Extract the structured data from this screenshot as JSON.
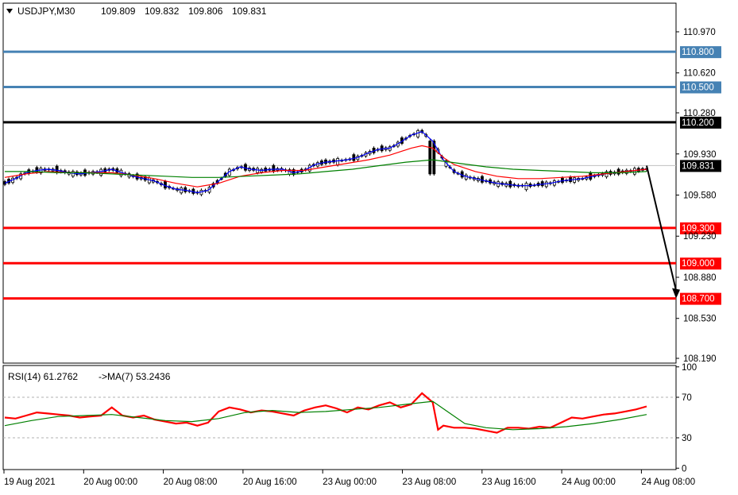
{
  "header": {
    "symbol": "USDJPY,M30",
    "open": "109.809",
    "high": "109.832",
    "low": "109.806",
    "close": "109.831"
  },
  "rsi_header": {
    "label": "RSI(14) 61.2762",
    "ma_label": "->MA(7) 53.2436"
  },
  "chart_data": [
    {
      "type": "candlestick",
      "title": "USDJPY,M30",
      "price_ticks": [
        "110.970",
        "110.620",
        "110.280",
        "109.930",
        "109.580",
        "109.230",
        "108.880",
        "108.530",
        "108.190"
      ],
      "ylim": [
        108.19,
        111.16
      ],
      "x_ticks": [
        "19 Aug 2021",
        "20 Aug 00:00",
        "20 Aug 08:00",
        "20 Aug 16:00",
        "23 Aug 00:00",
        "23 Aug 08:00",
        "23 Aug 16:00",
        "24 Aug 00:00",
        "24 Aug 08:00"
      ],
      "current_price": "109.831",
      "levels": [
        {
          "label": "110.800",
          "value": 110.8,
          "color": "#4682b4",
          "kind": "resistance"
        },
        {
          "label": "110.500",
          "value": 110.5,
          "color": "#4682b4",
          "kind": "resistance"
        },
        {
          "label": "110.200",
          "value": 110.2,
          "color": "#000000",
          "kind": "pivot"
        },
        {
          "label": "109.300",
          "value": 109.3,
          "color": "#ff0000",
          "kind": "support"
        },
        {
          "label": "109.000",
          "value": 109.0,
          "color": "#ff0000",
          "kind": "support"
        },
        {
          "label": "108.700",
          "value": 108.7,
          "color": "#ff0000",
          "kind": "support"
        }
      ],
      "series": [
        {
          "color": "#0000ff",
          "kind": "moving-average",
          "x": [
            0,
            4,
            8,
            12,
            16,
            20,
            24,
            28,
            32,
            36,
            40,
            44,
            48,
            52,
            56,
            60,
            64,
            68,
            72,
            76,
            80,
            84,
            88,
            92,
            96,
            100,
            104,
            108,
            112,
            116,
            120,
            124,
            128,
            132,
            136,
            140,
            144,
            148,
            152,
            156,
            160,
            164,
            168,
            172,
            176,
            180,
            184,
            188,
            192,
            196,
            200,
            204,
            208,
            212,
            216,
            220,
            224,
            228,
            232,
            236,
            240
          ],
          "y": [
            109.68,
            109.72,
            109.77,
            109.79,
            109.8,
            109.79,
            109.77,
            109.76,
            109.77,
            109.78,
            109.8,
            109.77,
            109.74,
            109.72,
            109.7,
            109.66,
            109.63,
            109.62,
            109.6,
            109.62,
            109.7,
            109.78,
            109.82,
            109.8,
            109.79,
            109.8,
            109.8,
            109.77,
            109.79,
            109.84,
            109.86,
            109.87,
            109.88,
            109.9,
            109.94,
            109.97,
            109.98,
            110.03,
            110.09,
            110.12,
            110.04,
            109.88,
            109.78,
            109.74,
            109.72,
            109.7,
            109.68,
            109.67,
            109.66,
            109.66,
            109.67,
            109.68,
            109.7,
            109.71,
            109.72,
            109.74,
            109.76,
            109.77,
            109.78,
            109.79,
            109.8
          ]
        },
        {
          "color": "#ff0000",
          "kind": "moving-average",
          "x": [
            0,
            8,
            16,
            24,
            32,
            40,
            48,
            56,
            64,
            72,
            80,
            88,
            96,
            104,
            112,
            120,
            128,
            136,
            144,
            152,
            156,
            160,
            164,
            168,
            176,
            184,
            192,
            200,
            208,
            216,
            224,
            232,
            240
          ],
          "y": [
            109.73,
            109.76,
            109.78,
            109.77,
            109.77,
            109.77,
            109.75,
            109.72,
            109.68,
            109.65,
            109.68,
            109.74,
            109.77,
            109.79,
            109.79,
            109.82,
            109.85,
            109.88,
            109.92,
            109.98,
            110.0,
            109.98,
            109.9,
            109.84,
            109.78,
            109.74,
            109.72,
            109.72,
            109.73,
            109.74,
            109.76,
            109.78,
            109.8
          ]
        },
        {
          "color": "#008000",
          "kind": "moving-average",
          "x": [
            0,
            10,
            20,
            30,
            40,
            50,
            60,
            70,
            80,
            90,
            100,
            110,
            120,
            130,
            140,
            150,
            160,
            170,
            180,
            190,
            200,
            210,
            220,
            230,
            240
          ],
          "y": [
            109.78,
            109.78,
            109.77,
            109.77,
            109.76,
            109.75,
            109.74,
            109.73,
            109.73,
            109.74,
            109.75,
            109.76,
            109.78,
            109.8,
            109.83,
            109.86,
            109.88,
            109.85,
            109.82,
            109.8,
            109.79,
            109.78,
            109.77,
            109.77,
            109.78
          ]
        }
      ],
      "forecast_arrow": {
        "from": [
          240,
          109.83
        ],
        "to": [
          251,
          108.7
        ],
        "color": "#000000"
      }
    },
    {
      "type": "line",
      "title": "RSI(14)",
      "ticks": [
        "100",
        "70",
        "30",
        "0"
      ],
      "ylim": [
        -5,
        103
      ],
      "levels": [
        70,
        30
      ],
      "series": [
        {
          "color": "#ff0000",
          "kind": "rsi",
          "x": [
            0,
            4,
            8,
            12,
            16,
            20,
            24,
            28,
            32,
            36,
            40,
            44,
            48,
            52,
            56,
            60,
            64,
            68,
            72,
            76,
            80,
            84,
            88,
            92,
            96,
            100,
            104,
            108,
            112,
            116,
            120,
            124,
            128,
            132,
            136,
            140,
            144,
            148,
            152,
            156,
            160,
            162,
            164,
            168,
            172,
            176,
            180,
            184,
            188,
            192,
            196,
            200,
            204,
            208,
            212,
            216,
            220,
            224,
            228,
            232,
            236,
            240
          ],
          "y": [
            50,
            49,
            52,
            55,
            54,
            53,
            52,
            50,
            51,
            52,
            60,
            52,
            50,
            52,
            48,
            46,
            44,
            45,
            42,
            45,
            56,
            60,
            58,
            55,
            57,
            56,
            54,
            52,
            57,
            60,
            62,
            59,
            55,
            60,
            58,
            62,
            65,
            60,
            63,
            74,
            65,
            38,
            42,
            40,
            40,
            39,
            37,
            35,
            40,
            40,
            39,
            41,
            40,
            45,
            50,
            49,
            51,
            53,
            54,
            56,
            58,
            61
          ]
        },
        {
          "color": "#008000",
          "kind": "ma",
          "x": [
            0,
            10,
            20,
            30,
            40,
            50,
            60,
            70,
            80,
            90,
            100,
            110,
            120,
            130,
            140,
            150,
            160,
            166,
            172,
            180,
            190,
            200,
            210,
            220,
            230,
            240
          ],
          "y": [
            42,
            47,
            51,
            52,
            53,
            50,
            47,
            46,
            49,
            55,
            57,
            55,
            56,
            58,
            60,
            63,
            66,
            55,
            44,
            40,
            38,
            39,
            41,
            44,
            48,
            53
          ]
        }
      ]
    }
  ]
}
